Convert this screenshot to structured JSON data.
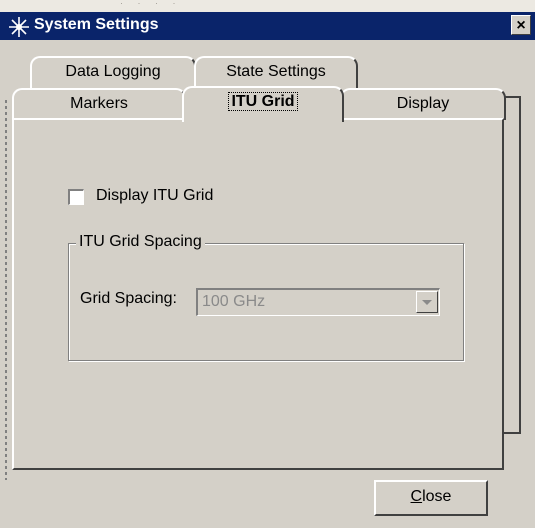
{
  "window": {
    "title": "System Settings",
    "title_bar_color": "#0a246a",
    "close_glyph": "×",
    "icon": "sparkle-icon"
  },
  "background_strip_text": "· · · ·",
  "tabs": {
    "row1": [
      {
        "label": "Data Logging"
      },
      {
        "label": "State Settings"
      }
    ],
    "row2": [
      {
        "label": "Markers"
      },
      {
        "label": "ITU Grid",
        "active": true
      },
      {
        "label": "Display"
      }
    ]
  },
  "itu_grid": {
    "display_checkbox_label": "Display ITU Grid",
    "display_checked": false,
    "group_title": "ITU Grid Spacing",
    "spacing_label": "Grid Spacing:",
    "spacing_value": "100 GHz",
    "spacing_enabled": false
  },
  "footer": {
    "close_label_prefix": "",
    "close_label_mnemonic": "C",
    "close_label_rest": "lose"
  }
}
